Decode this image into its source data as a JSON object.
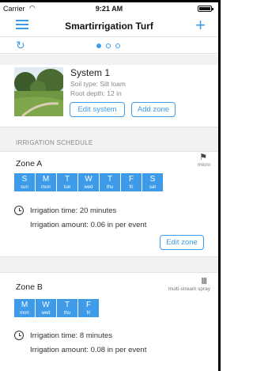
{
  "status_bar": {
    "carrier": "Carrier",
    "wifi": "◠",
    "time": "9:21 AM"
  },
  "header": {
    "title": "Smartirrigation Turf",
    "add": "+"
  },
  "subnav": {
    "refresh": "↻",
    "page_count": 3,
    "active_page": 1
  },
  "system": {
    "name": "System 1",
    "soil_type": "Soil type: Silt loam",
    "root_depth": "Root depth: 12 in",
    "edit_label": "Edit system",
    "add_zone_label": "Add zone"
  },
  "schedule": {
    "section_label": "IRRIGATION SCHEDULE"
  },
  "zones": [
    {
      "title": "Zone A",
      "sprinkler_type": "micro",
      "days": [
        {
          "letter": "S",
          "abbr": "sun"
        },
        {
          "letter": "M",
          "abbr": "mon"
        },
        {
          "letter": "T",
          "abbr": "tue"
        },
        {
          "letter": "W",
          "abbr": "wed"
        },
        {
          "letter": "T",
          "abbr": "thu"
        },
        {
          "letter": "F",
          "abbr": "fri"
        },
        {
          "letter": "S",
          "abbr": "sat"
        }
      ],
      "irrigation_time": "Irrigation time: 20 minutes",
      "irrigation_amount": "Irrigation amount: 0.06 in per event",
      "edit_label": "Edit zone"
    },
    {
      "title": "Zone B",
      "sprinkler_type": "multi-stream spray",
      "days": [
        {
          "letter": "M",
          "abbr": "mon"
        },
        {
          "letter": "W",
          "abbr": "wed"
        },
        {
          "letter": "T",
          "abbr": "thu"
        },
        {
          "letter": "F",
          "abbr": "fri"
        }
      ],
      "irrigation_time": "Irrigation time: 8 minutes",
      "irrigation_amount": "Irrigation amount: 0.08 in per event"
    }
  ],
  "colors": {
    "accent": "#3d9be9",
    "section_bg": "#f2f2f4"
  }
}
